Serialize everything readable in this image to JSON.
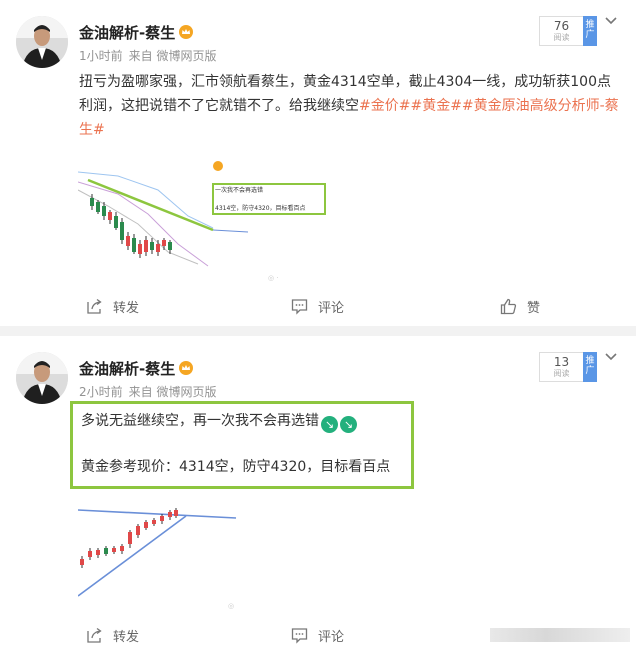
{
  "colors": {
    "tag": "#eb7350",
    "promote": "#5a96e6",
    "highlight_border": "#8dc63f",
    "emoji_green": "#23b07d"
  },
  "posts": [
    {
      "author": "金油解析-蔡生",
      "time": "1小时前",
      "source": "来自 微博网页版",
      "read_count": "76",
      "read_label": "阅读",
      "promote_label": "推广",
      "text_plain": "扭亏为盈哪家强，汇市领航看蔡生，黄金4314空单，截止4304一线，成功斩获100点利润，这把说错不了它就错不了。给我继续空",
      "tags": "#金价##黄金##黄金原油高级分析师-蔡生#",
      "thumb": {
        "line1": "一次我不会再选错",
        "line2": "4314空，防守4320，目标看百点"
      },
      "actions": {
        "repost": "转发",
        "comment": "评论",
        "like": "赞"
      }
    },
    {
      "author": "金油解析-蔡生",
      "time": "2小时前",
      "source": "来自 微博网页版",
      "read_count": "13",
      "read_label": "阅读",
      "promote_label": "推广",
      "quote": {
        "line1": "多说无益继续空，再一次我不会再选错",
        "line2": "黄金参考现价：4314空，防守4320，目标看百点"
      },
      "actions": {
        "repost": "转发",
        "comment": "评论"
      }
    }
  ]
}
